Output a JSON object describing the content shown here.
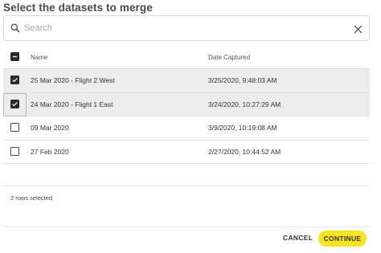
{
  "dialog": {
    "title": "Select the datasets to merge"
  },
  "search": {
    "placeholder": "Search",
    "value": ""
  },
  "table": {
    "columns": [
      "Name",
      "Date Captured"
    ],
    "header_checkbox": "indeterminate",
    "rows": [
      {
        "name": "25 Mar 2020 - Flight 2 West",
        "date": "3/25/2020, 9:48:03 AM",
        "checked": true
      },
      {
        "name": "24 Mar 2020 - Flight 1 East",
        "date": "3/24/2020, 10:27:29 AM",
        "checked": true
      },
      {
        "name": "09 Mar 2020",
        "date": "3/9/2020, 10:19:08 AM",
        "checked": false
      },
      {
        "name": "27 Feb 2020",
        "date": "2/27/2020, 10:44:52 AM",
        "checked": false
      }
    ]
  },
  "status": {
    "rows_selected": "2 rows selected"
  },
  "actions": {
    "cancel_label": "CANCEL",
    "continue_label": "CONTINUE"
  },
  "colors": {
    "accent": "#f6e420",
    "selected_row": "#ececec"
  }
}
